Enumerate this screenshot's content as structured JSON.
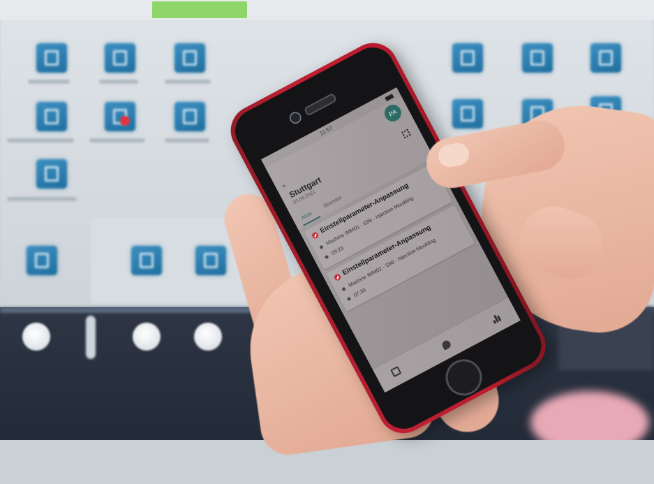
{
  "phone_app": {
    "status_time": "11:57",
    "avatar_initials": "PA",
    "location_title": "Stuttgart",
    "date": "03.08.2021",
    "tabs": [
      {
        "label": "Aktiv",
        "active": true
      },
      {
        "label": "Beendet",
        "active": false
      }
    ],
    "tasks": [
      {
        "title": "Einstellparameter-Anpassung",
        "machine": "Machine IMM01 - S99 - Injection Moulding",
        "time": "09:23"
      },
      {
        "title": "Einstellparameter-Anpassung",
        "machine": "Machine IMM02 - S99 - Injection Moulding",
        "time": "07:30"
      }
    ],
    "bottom_nav": [
      "calendar-icon",
      "chat-icon",
      "bar-chart-icon"
    ],
    "accent_color": "#2a5e5a",
    "alert_color": "#c2252f"
  }
}
